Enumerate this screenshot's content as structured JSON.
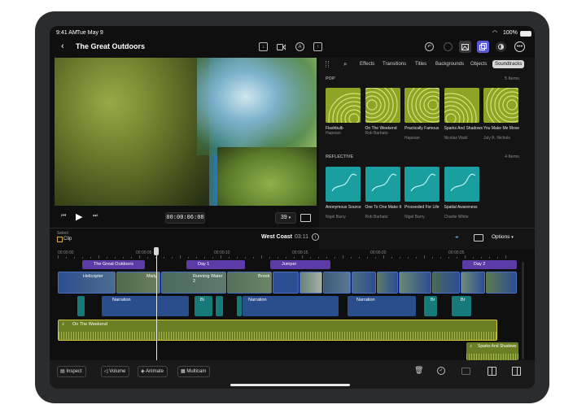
{
  "status": {
    "time": "9:41 AM",
    "date": "Tue May 9",
    "battery": "100%"
  },
  "header": {
    "title": "The Great Outdoors"
  },
  "viewer": {
    "timecode": "00:00:06:08",
    "zoom": "39"
  },
  "browser": {
    "tabs": [
      "Effects",
      "Transitions",
      "Titles",
      "Backgrounds",
      "Objects",
      "Soundtracks"
    ],
    "active_tab": "Soundtracks",
    "sections": [
      {
        "name": "POP",
        "count": "5 Items",
        "items": [
          {
            "title": "Flashbulb",
            "artist": "Hapeian"
          },
          {
            "title": "On The Weekend",
            "artist": "Rob Barbato"
          },
          {
            "title": "Practically Famous",
            "artist": "Hapeian"
          },
          {
            "title": "Sparks And Shadows",
            "artist": "Nicolas Wahl"
          },
          {
            "title": "You Make Me Move",
            "artist": "July B. Nichols"
          }
        ]
      },
      {
        "name": "REFLECTIVE",
        "count": "4 Items",
        "items": [
          {
            "title": "Anonymous Source",
            "artist": "Nigel Barry"
          },
          {
            "title": "One To One Make It",
            "artist": "Rob Barbato"
          },
          {
            "title": "Proceeded For Life",
            "artist": "Nigel Barry"
          },
          {
            "title": "Spatial Awareness",
            "artist": "Charlie White"
          }
        ]
      }
    ]
  },
  "timeline": {
    "select_label": "Select",
    "clip_label": "Clip",
    "project_name": "West Coast",
    "duration": "03:11",
    "options_label": "Options",
    "ruler": [
      "00:00:00",
      "00:00:05",
      "00:00:10",
      "00:00:15",
      "00:00:20",
      "00:00:25"
    ],
    "markers": [
      "The Great Outdoors",
      "Day 1",
      "Jumper",
      "Day 2"
    ],
    "video_clips": [
      "Helicopter",
      "Misty",
      "Running Water 2",
      "Brook"
    ],
    "audio_clips": [
      "Narration",
      "Bi",
      "Narration",
      "Narration",
      "Br",
      "Br"
    ],
    "music_clip": "On The Weekend",
    "music_clip_2": "Sparks And Shadows"
  },
  "toolbar": {
    "inspect": "Inspect",
    "volume": "Volume",
    "animate": "Animate",
    "multicam": "Multicam"
  }
}
